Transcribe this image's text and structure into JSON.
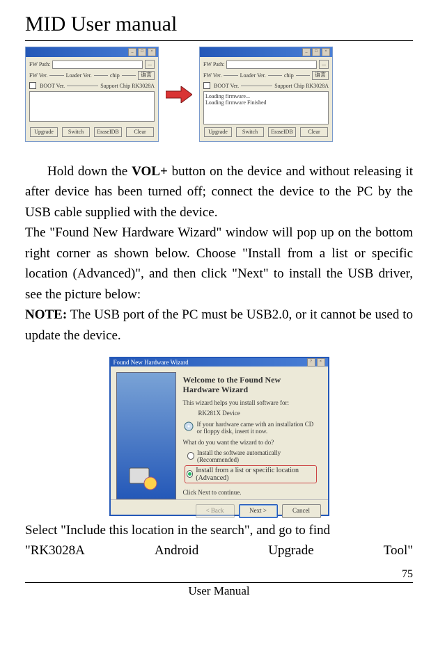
{
  "header": {
    "title": "MID User manual"
  },
  "screenshots": {
    "left": {
      "titlebar": "",
      "min": "_",
      "max": "□",
      "close": "×",
      "fwpath_label": "FW Path:",
      "fwver_label": "FW Ver.",
      "boot_label": "BOOT Ver.",
      "support_label": "Support Chip  RK3028A",
      "loader_label": "Loader Ver.",
      "lang_btn": "语言",
      "chip_label": "chip",
      "btn_upgrade": "Upgrade",
      "btn_switch": "Switch",
      "btn_erase": "EraseIDB",
      "btn_clear": "Clear"
    },
    "right": {
      "titlebar": "",
      "min": "_",
      "max": "□",
      "close": "×",
      "msg1": "Loading firmware...",
      "msg2": "Loading firmware Finished"
    }
  },
  "body": {
    "para1_frag1": "Hold down the ",
    "para1_bold": "VOL+",
    "para1_frag2": " button on the device and without releasing it after device has been turned off; connect the device to the PC by the USB cable supplied with the device.",
    "para2": "The \"Found New Hardware Wizard\" window will pop up on the bottom right corner as shown below. Choose \"Install from a list or specific location (Advanced)\", and then click \"Next\" to install the USB driver, see the picture below:",
    "note_label": "NOTE:",
    "note_text": " The USB port of the PC must be USB2.0, or it cannot be used to update the device."
  },
  "wizard": {
    "titlebar": "Found New Hardware Wizard",
    "heading": "Welcome to the Found New Hardware Wizard",
    "line1": "This wizard helps you install software for:",
    "device": "RK281X Device",
    "cdhint": "If your hardware came with an installation CD or floppy disk, insert it now.",
    "question": "What do you want the wizard to do?",
    "radio1": "Install the software automatically (Recommended)",
    "radio2": "Install from a list or specific location (Advanced)",
    "clicknext": "Click Next to continue.",
    "btn_back": "< Back",
    "btn_next": "Next >",
    "btn_cancel": "Cancel"
  },
  "after": {
    "line1": "Select \"Include this location in the search\", and go to find",
    "line2_a": "\"RK3028A",
    "line2_b": "Android",
    "line2_c": "Upgrade",
    "line2_d": "Tool\""
  },
  "footer": {
    "pagenum": "75",
    "text": "User Manual"
  }
}
